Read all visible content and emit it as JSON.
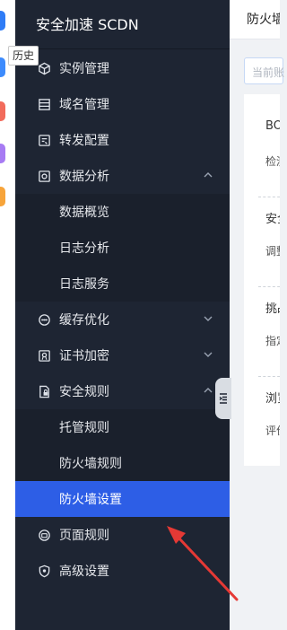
{
  "tooltip": "历史",
  "sidebar": {
    "title": "安全加速 SCDN",
    "items": [
      {
        "label": "实例管理"
      },
      {
        "label": "域名管理"
      },
      {
        "label": "转发配置"
      },
      {
        "label": "数据分析"
      },
      {
        "label": "数据概览"
      },
      {
        "label": "日志分析"
      },
      {
        "label": "日志服务"
      },
      {
        "label": "缓存优化"
      },
      {
        "label": "证书加密"
      },
      {
        "label": "安全规则"
      },
      {
        "label": "托管规则"
      },
      {
        "label": "防火墙规则"
      },
      {
        "label": "防火墙设置"
      },
      {
        "label": "页面规则"
      },
      {
        "label": "高级设置"
      }
    ],
    "active_item": "防火墙设置"
  },
  "main": {
    "tab": "防火墙",
    "input_placeholder": "当前账",
    "rows": [
      "BO",
      "检测",
      "安全",
      "调整",
      "挑战",
      "指定",
      "浏览",
      "评价"
    ]
  },
  "colors": {
    "sidebar_bg": "#1e2533",
    "active": "#2d5ee6",
    "arrow": "#e53935"
  }
}
